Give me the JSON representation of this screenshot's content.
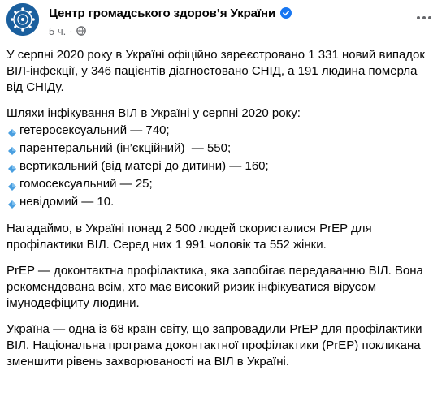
{
  "post": {
    "author": "Центр громадського здоров’я України",
    "time": "5 ч.",
    "dot": "·",
    "paragraphs": [
      "У серпні 2020 року в Україні офіційно зареєстровано 1 331 новий випадок ВІЛ-інфекції, у 346 пацієнтів діагностовано СНІД, а 191 людина померла від СНІДу.",
      "Нагадаймо, в Україні понад 2 500 людей скористалися PrEP для профілактики ВІЛ. Серед них 1 991 чоловік та 552 жінки.",
      "PrEP — доконтактна профілактика, яка запобігає передаванню ВІЛ. Вона рекомендована всім, хто має високий ризик інфікуватися вірусом імунодефіциту людини.",
      "Україна — одна із 68 країн світу, що запровадили PrEP для профілактики ВІЛ. Національна програма доконтактної профілактики (PrEP) покликана зменшити рівень захворюваності на ВІЛ в Україні."
    ],
    "routes": {
      "title": "Шляхи інфікування ВІЛ в Україні у серпні 2020 року:",
      "items": [
        "гетеросексуальний — 740;",
        "парентеральний (ін’єкційний)  — 550;",
        "вертикальний (від матері до дитини) — 160;",
        "гомосексуальний — 25;",
        "невідомий — 10."
      ]
    }
  },
  "icons": {
    "avatar": "organization-logo",
    "verified": "verified-badge-icon",
    "audience": "globe-icon",
    "more": "more-options-icon",
    "bullet": "small-blue-diamond-icon"
  },
  "colors": {
    "text": "#050505",
    "secondary": "#65676b",
    "verified": "#1877f2",
    "diamond": "#4a9fe0",
    "avatar": "#1a5f9e"
  }
}
